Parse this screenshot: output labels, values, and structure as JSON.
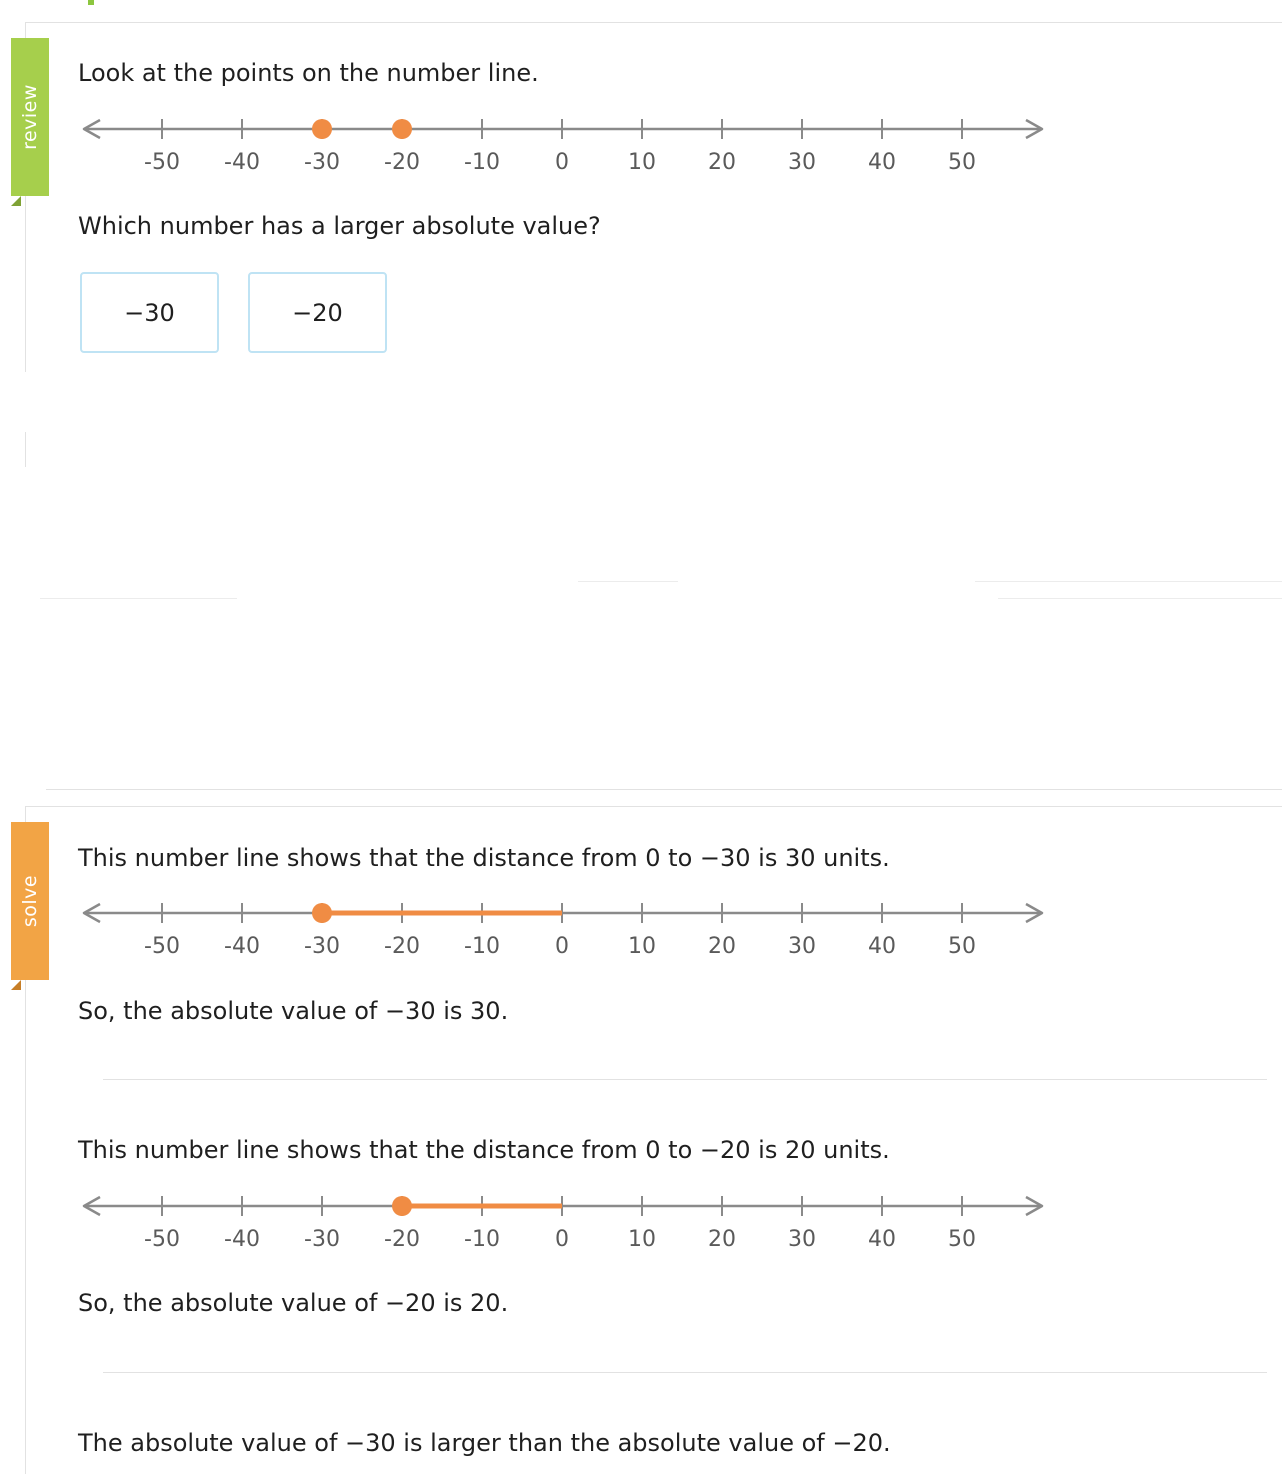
{
  "review": {
    "ribbon_label": "review",
    "ribbon_color": "#a6cf4c",
    "prompt": "Look at the points on the number line.",
    "question": "Which number has a larger absolute value?",
    "choices": [
      "−30",
      "−20"
    ],
    "number_line": {
      "ticks": [
        "-50",
        "-40",
        "-30",
        "-20",
        "-10",
        "0",
        "10",
        "20",
        "30",
        "40",
        "50"
      ],
      "points": [
        -30,
        -20
      ]
    }
  },
  "solve": {
    "ribbon_label": "solve",
    "ribbon_color": "#f2a445",
    "step1": {
      "text": "This number line shows that the distance from 0 to −30 is 30 units.",
      "conclusion": "So, the absolute value of −30 is 30.",
      "number_line": {
        "ticks": [
          "-50",
          "-40",
          "-30",
          "-20",
          "-10",
          "0",
          "10",
          "20",
          "30",
          "40",
          "50"
        ],
        "point": -30,
        "segment": [
          -30,
          0
        ]
      }
    },
    "step2": {
      "text": "This number line shows that the distance from 0 to −20 is 20 units.",
      "conclusion": "So, the absolute value of −20 is 20.",
      "number_line": {
        "ticks": [
          "-50",
          "-40",
          "-30",
          "-20",
          "-10",
          "0",
          "10",
          "20",
          "30",
          "40",
          "50"
        ],
        "point": -20,
        "segment": [
          -20,
          0
        ]
      }
    },
    "final": "The absolute value of −30 is larger than the absolute value of −20."
  },
  "colors": {
    "accent_point": "#f08c44",
    "axis": "#8a8a8a",
    "choice_border": "#bfe3f4"
  }
}
